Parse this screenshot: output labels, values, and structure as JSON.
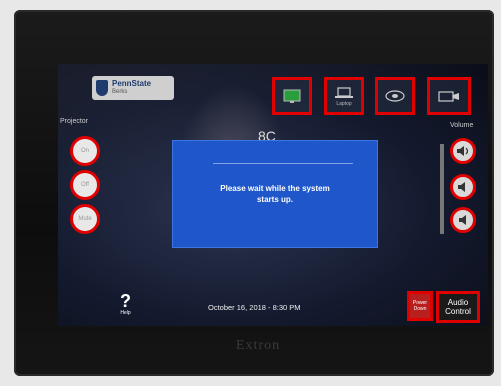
{
  "panel": {
    "logo": {
      "line1": "PennState",
      "line2": "Berks"
    },
    "source_buttons": [
      {
        "icon": "wall-display-icon",
        "label": ""
      },
      {
        "icon": "laptop-icon",
        "label": "Laptop"
      },
      {
        "icon": "bluray-disc-icon",
        "label": ""
      },
      {
        "icon": "document-camera-icon",
        "label": ""
      }
    ],
    "projector": {
      "label": "Projector",
      "buttons": [
        "On",
        "Off",
        "Mute"
      ]
    },
    "volume": {
      "label": "Volume",
      "buttons": [
        "volume-up-icon",
        "volume-down-icon",
        "volume-mute-icon"
      ]
    },
    "dialog": {
      "message_line1": "Please wait while the system",
      "message_line2": "starts up."
    },
    "background_text": "8C",
    "help_label": "Help",
    "datetime": "October 16, 2018 - 8:30 PM",
    "power_button": {
      "line1": "Power",
      "line2": "Down"
    },
    "audio_button": {
      "line1": "Audio",
      "line2": "Control"
    },
    "brand": "Extron",
    "colors": {
      "highlight": "#e00000",
      "dialog": "#1f56c9"
    }
  }
}
